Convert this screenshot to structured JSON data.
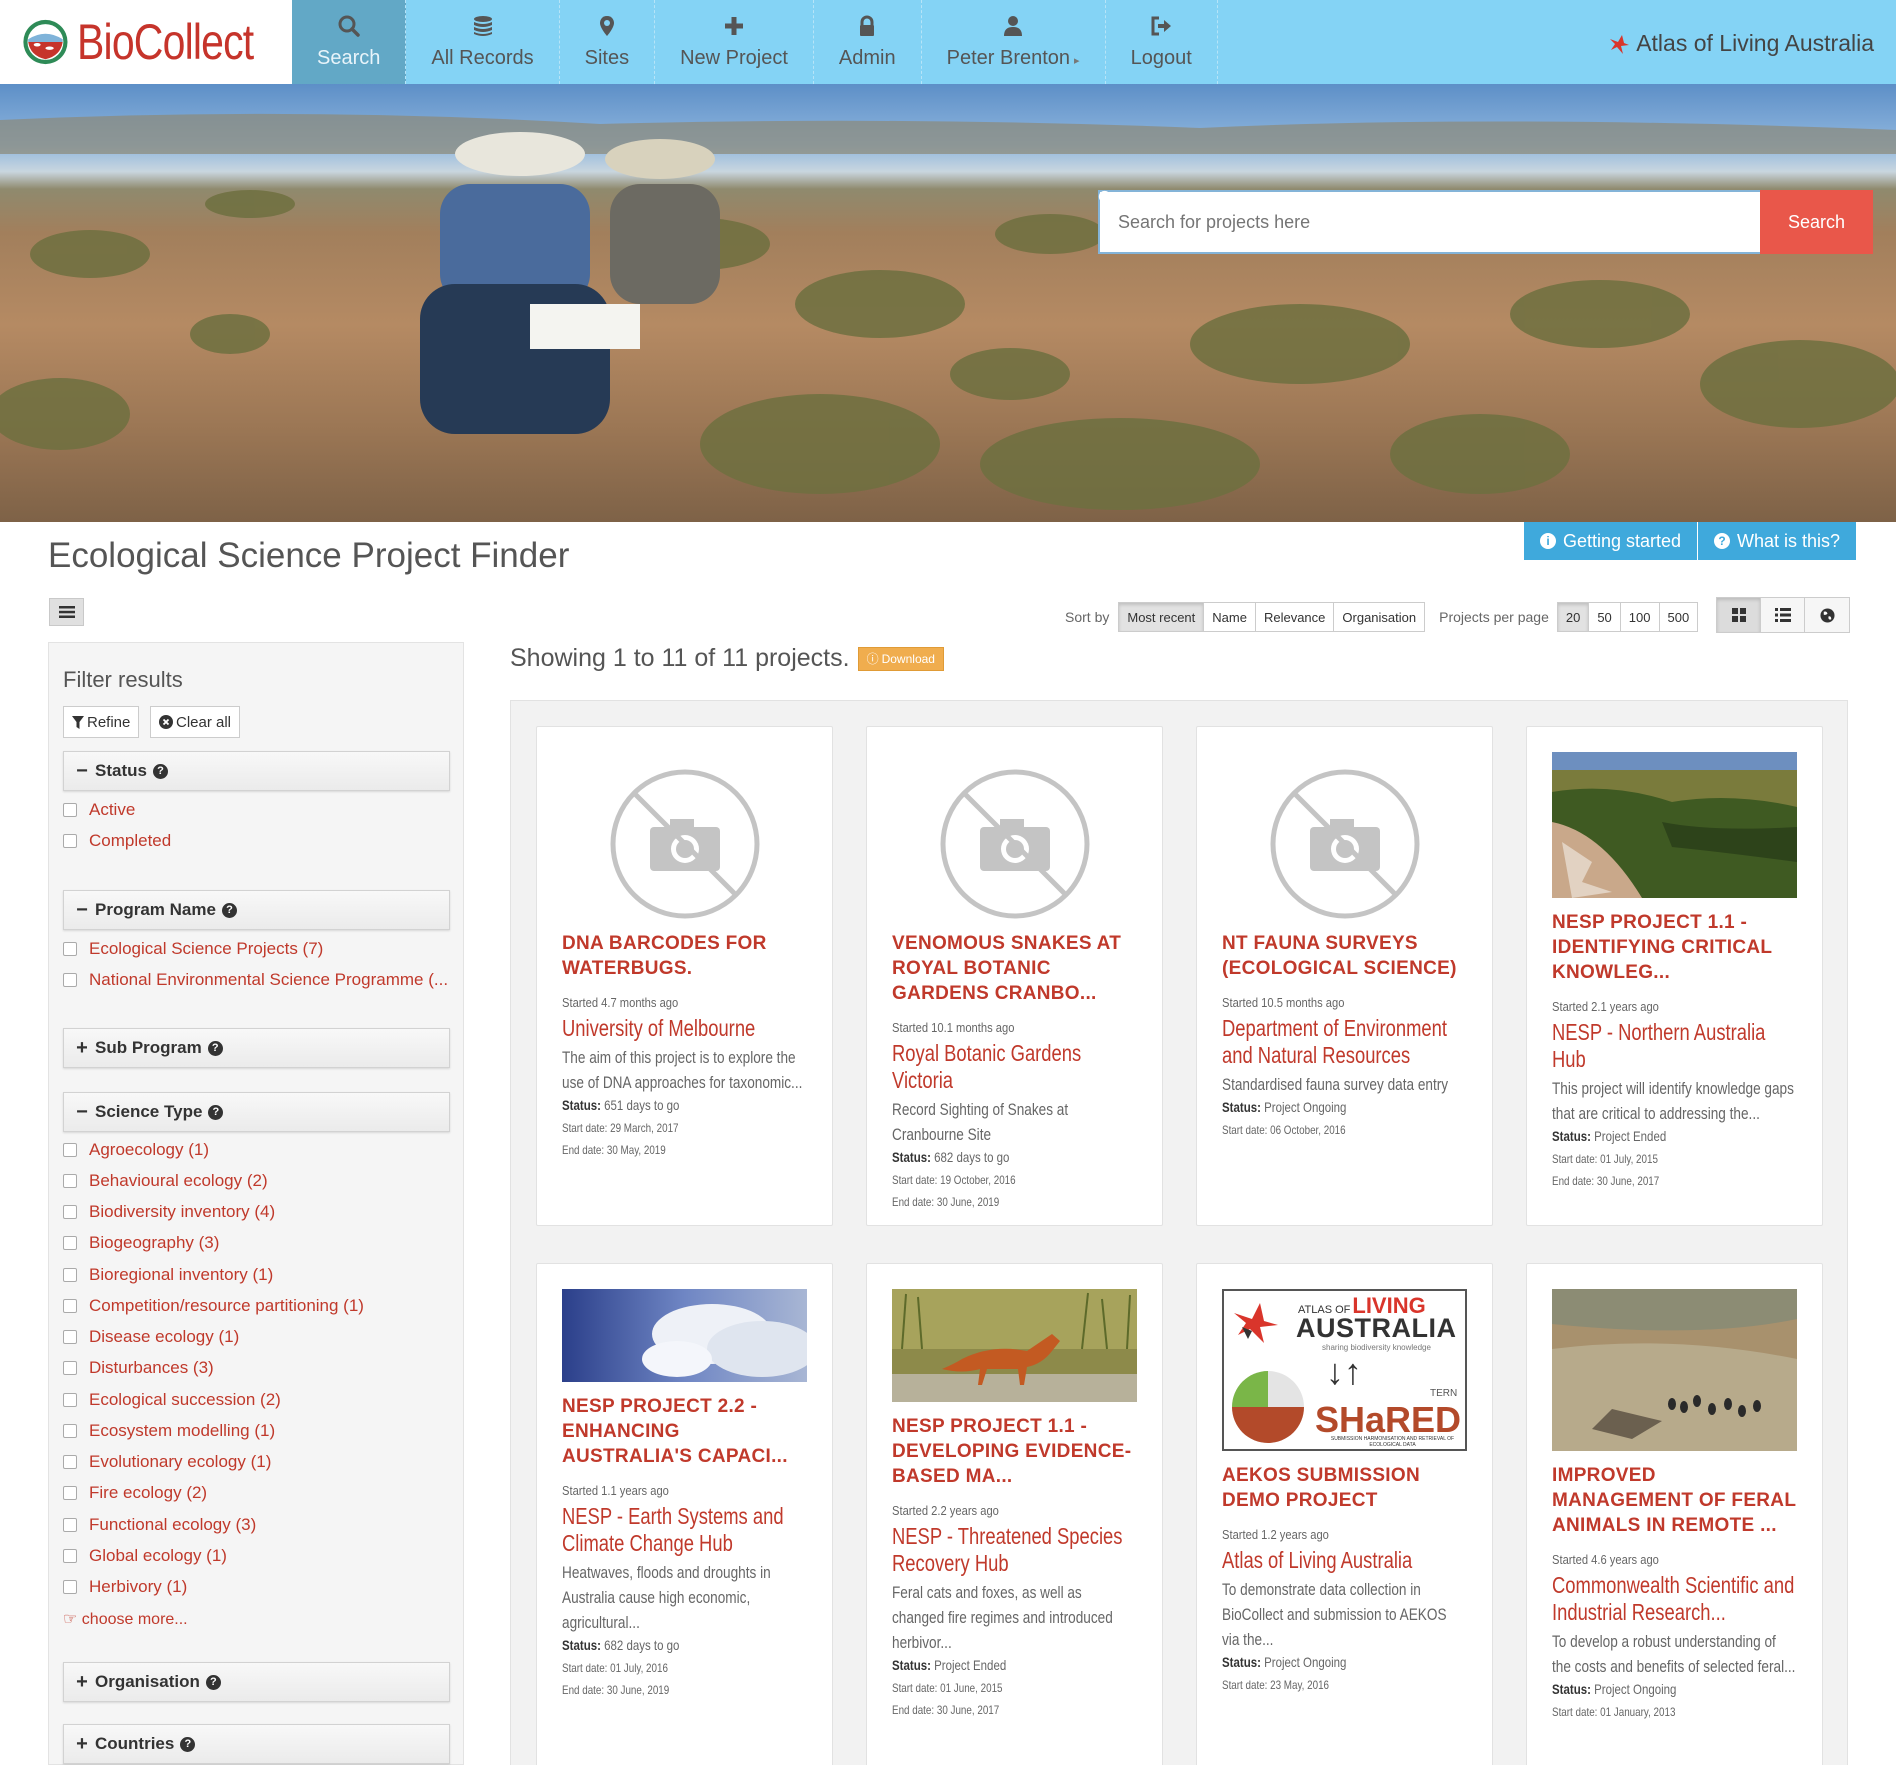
{
  "brand": {
    "name": "BioCollect"
  },
  "nav": [
    {
      "label": "Search",
      "icon": "search-icon",
      "active": true
    },
    {
      "label": "All Records",
      "icon": "database-icon"
    },
    {
      "label": "Sites",
      "icon": "map-marker-icon"
    },
    {
      "label": "New Project",
      "icon": "plus-icon"
    },
    {
      "label": "Admin",
      "icon": "lock-icon"
    },
    {
      "label": "Peter Brenton",
      "icon": "user-icon"
    },
    {
      "label": "Logout",
      "icon": "logout-icon"
    }
  ],
  "ala_link": "Atlas of Living Australia",
  "hero": {
    "search_placeholder": "Search for projects here",
    "search_button": "Search"
  },
  "page": {
    "title": "Ecological Science Project Finder",
    "getting_started": "Getting started",
    "what_is_this": "What is this?"
  },
  "sort": {
    "label": "Sort by",
    "options": [
      "Most recent",
      "Name",
      "Relevance",
      "Organisation"
    ],
    "selected": "Most recent"
  },
  "per_page": {
    "label": "Projects per page",
    "options": [
      "20",
      "50",
      "100",
      "500"
    ],
    "selected": "20"
  },
  "results": {
    "showing": "Showing 1 to 11 of 11 projects.",
    "download": "Download"
  },
  "sidebar": {
    "title": "Filter results",
    "refine": "Refine",
    "clear_all": "Clear all",
    "status": {
      "label": "Status",
      "options": [
        "Active",
        "Completed"
      ]
    },
    "program": {
      "label": "Program Name",
      "options": [
        "Ecological Science Projects (7)",
        "National Environmental Science Programme (..."
      ]
    },
    "sub_program": {
      "label": "Sub Program"
    },
    "science_type": {
      "label": "Science Type",
      "options": [
        "Agroecology (1)",
        "Behavioural ecology (2)",
        "Biodiversity inventory (4)",
        "Biogeography (3)",
        "Bioregional inventory (1)",
        "Competition/resource partitioning (1)",
        "Disease ecology (1)",
        "Disturbances (3)",
        "Ecological succession (2)",
        "Ecosystem modelling (1)",
        "Evolutionary ecology (1)",
        "Fire ecology (2)",
        "Functional ecology (3)",
        "Global ecology (1)",
        "Herbivory (1)"
      ],
      "choose_more": "choose more..."
    },
    "organisation": {
      "label": "Organisation"
    },
    "countries": {
      "label": "Countries"
    }
  },
  "projects": [
    {
      "title": "DNA BARCODES FOR WATERBUGS.",
      "started": "Started 4.7 months ago",
      "org": "University of Melbourne",
      "desc": "The aim of this project is to explore the use of DNA approaches for taxonomic...",
      "status_label": "Status:",
      "status": "651 days to go",
      "start_date": "Start date: 29 March, 2017",
      "end_date": "End date: 30 May, 2019",
      "image": "no-image-icon"
    },
    {
      "title": "VENOMOUS SNAKES AT ROYAL BOTANIC GARDENS CRANBO...",
      "started": "Started 10.1 months ago",
      "org": "Royal Botanic Gardens Victoria",
      "desc": "Record Sighting of Snakes at Cranbourne Site",
      "status_label": "Status:",
      "status": "682 days to go",
      "start_date": "Start date: 19 October, 2016",
      "end_date": "End date: 30 June, 2019",
      "image": "no-image-icon"
    },
    {
      "title": "NT FAUNA SURVEYS (ECOLOGICAL SCIENCE)",
      "started": "Started 10.5 months ago",
      "org": "Department of Environment and Natural Resources",
      "desc": "Standardised fauna survey data entry",
      "status_label": "Status:",
      "status": "Project Ongoing",
      "start_date": "Start date: 06 October, 2016",
      "end_date": "",
      "image": "no-image-icon"
    },
    {
      "title": "NESP PROJECT 1.1 - IDENTIFYING CRITICAL KNOWLEG...",
      "started": "Started 2.1 years ago",
      "org": "NESP - Northern Australia Hub",
      "desc": "This project will identify knowledge gaps that are critical to addressing the...",
      "status_label": "Status:",
      "status": "Project Ended",
      "start_date": "Start date: 01 July, 2015",
      "end_date": "End date: 30 June, 2017",
      "image": "gorge-photo"
    },
    {
      "title": "NESP PROJECT 2.2 - ENHANCING AUSTRALIA'S CAPACI...",
      "started": "Started 1.1 years ago",
      "org": "NESP - Earth Systems and Climate Change Hub",
      "desc": "Heatwaves, floods and droughts in Australia cause high economic, agricultural...",
      "status_label": "Status:",
      "status": "682 days to go",
      "start_date": "Start date: 01 July, 2016",
      "end_date": "End date: 30 June, 2019",
      "image": "sky-photo"
    },
    {
      "title": "NESP PROJECT 1.1 - DEVELOPING EVIDENCE-BASED MA...",
      "started": "Started 2.2 years ago",
      "org": "NESP - Threatened Species Recovery Hub",
      "desc": "Feral cats and foxes, as well as changed fire regimes and introduced herbivor...",
      "status_label": "Status:",
      "status": "Project Ended",
      "start_date": "Start date: 01 June, 2015",
      "end_date": "End date: 30 June, 2017",
      "image": "fox-photo"
    },
    {
      "title": "AEKOS SUBMISSION DEMO PROJECT",
      "started": "Started 1.2 years ago",
      "org": "Atlas of Living Australia",
      "desc": "To demonstrate data collection in BioCollect and submission to AEKOS via the...",
      "status_label": "Status:",
      "status": "Project Ongoing",
      "start_date": "Start date: 23 May, 2016",
      "end_date": "",
      "image": "ala-shared-logo",
      "logo_text": {
        "atlas_of": "ATLAS OF",
        "living": "LIVING",
        "australia": "AUSTRALIA",
        "tagline": "sharing biodiversity knowledge",
        "tern": "TERN",
        "shared": "SHaRED",
        "shared_sub": "SUBMISSION HARMONISATION AND RETRIEVAL OF ECOLOGICAL DATA"
      }
    },
    {
      "title": "IMPROVED MANAGEMENT OF FERAL ANIMALS IN REMOTE ...",
      "started": "Started 4.6 years ago",
      "org": "Commonwealth Scientific and Industrial Research...",
      "desc": "To develop a robust understanding of the costs and benefits of selected feral...",
      "status_label": "Status:",
      "status": "Project Ongoing",
      "start_date": "Start date: 01 January, 2013",
      "end_date": "",
      "image": "aerial-photo"
    }
  ],
  "colors": {
    "nav_bg": "#84d3f5",
    "nav_active": "#62a8c6",
    "accent_red": "#c0392b",
    "search_button": "#e9574a",
    "info_button": "#3fa9dc",
    "download": "#f0ad4e"
  }
}
